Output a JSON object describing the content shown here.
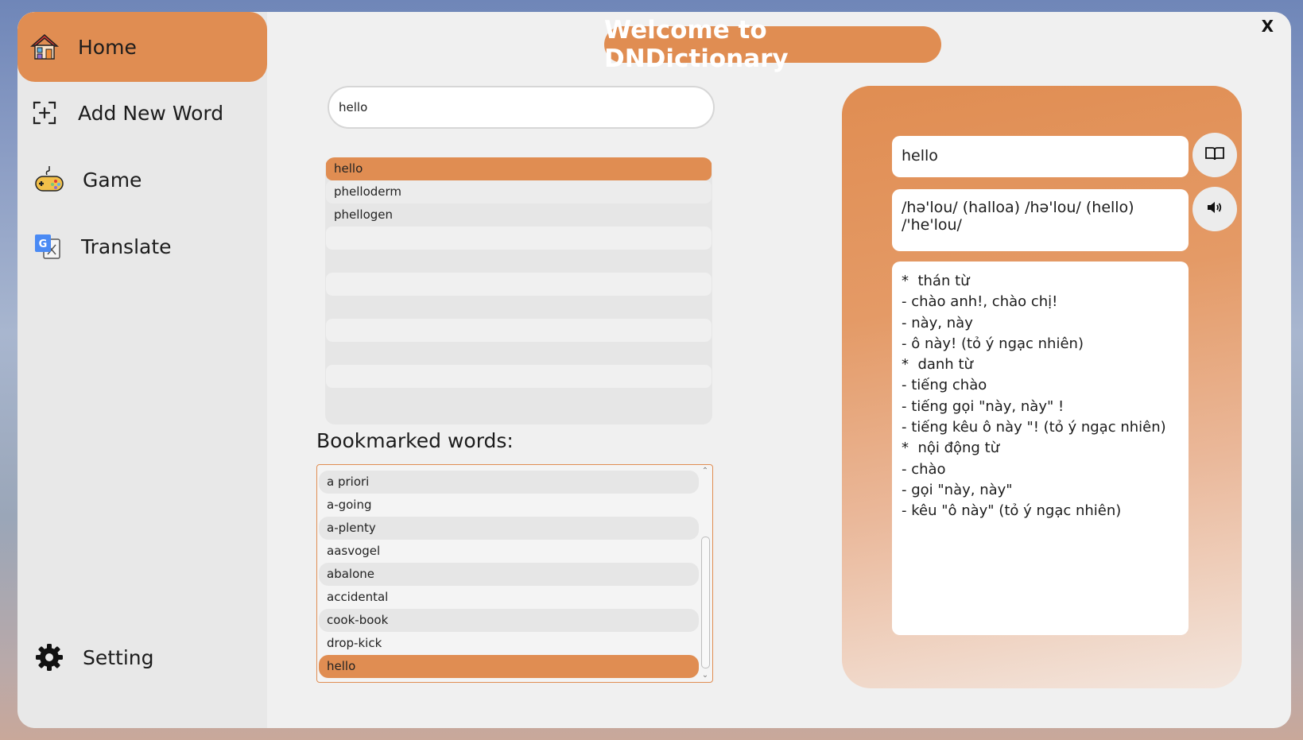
{
  "nav": {
    "home": "Home",
    "add_new_word": "Add New Word",
    "game": "Game",
    "translate": "Translate",
    "setting": "Setting"
  },
  "header": {
    "title": "Welcome to DNDictionary",
    "close": "X"
  },
  "search": {
    "value": "hello"
  },
  "suggestions": [
    "hello",
    "phelloderm",
    "phellogen"
  ],
  "bookmarks": {
    "heading": "Bookmarked words:",
    "items": [
      "a priori",
      "a-going",
      "a-plenty",
      "aasvogel",
      "abalone",
      "accidental",
      "cook-book",
      "drop-kick",
      "hello"
    ]
  },
  "detail": {
    "word": "hello",
    "pronunciation": "/hə'lou/ (halloa) /hə'lou/ (hello) /'he'lou/",
    "definition": [
      "*  thán từ",
      "- chào anh!, chào chị!",
      "- này, này",
      "- ô này! (tỏ ý ngạc nhiên)",
      "*  danh từ",
      "- tiếng chào",
      "- tiếng gọi \"này, này\" !",
      "- tiếng kêu ô này \"! (tỏ ý ngạc nhiên)",
      "*  nội động từ",
      "- chào",
      "- gọi \"này, này\"",
      "- kêu \"ô này\" (tỏ ý ngạc nhiên)"
    ]
  },
  "icons": {
    "home": "house-icon",
    "add": "add-square-icon",
    "game": "gamepad-icon",
    "translate": "google-translate-icon",
    "setting": "gear-icon",
    "dictionary": "open-book-icon",
    "speak": "speaker-icon"
  },
  "colors": {
    "accent": "#e08d52",
    "sidebar": "#e8e8e8",
    "background": "#f0f0f0"
  }
}
